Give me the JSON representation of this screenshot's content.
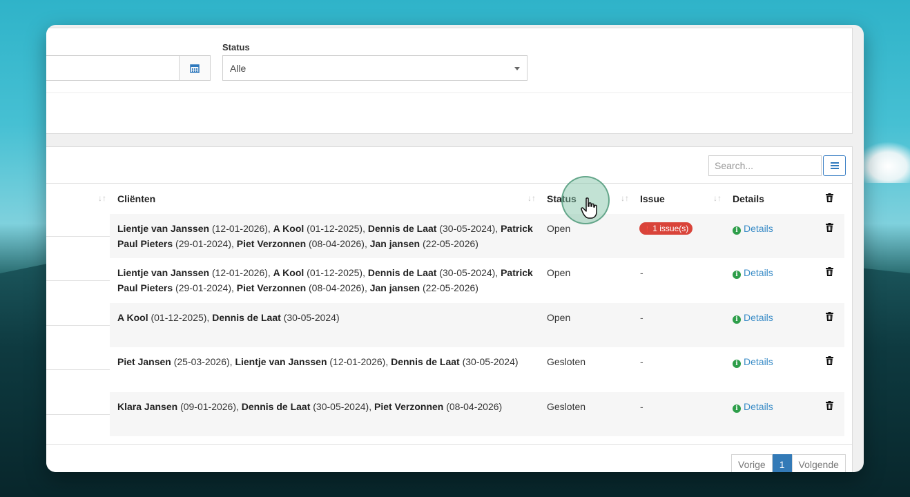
{
  "filters": {
    "status_label": "Status",
    "status_value": "Alle"
  },
  "table": {
    "search_placeholder": "Search...",
    "headers": {
      "clienten": "Cliënten",
      "status": "Status",
      "issue": "Issue",
      "details": "Details"
    },
    "rows": [
      {
        "clients": [
          {
            "name": "Lientje van Janssen",
            "date": "(12-01-2026)"
          },
          {
            "name": "A Kool",
            "date": "(01-12-2025)"
          },
          {
            "name": "Dennis de Laat",
            "date": "(30-05-2024)"
          },
          {
            "name": "Patrick Paul Pieters",
            "date": "(29-01-2024)"
          },
          {
            "name": "Piet Verzonnen",
            "date": "(08-04-2026)"
          },
          {
            "name": "Jan jansen",
            "date": "(22-05-2026)"
          }
        ],
        "status": "Open",
        "issue": "1 issue(s)",
        "issue_is_badge": true,
        "details": "Details"
      },
      {
        "clients": [
          {
            "name": "Lientje van Janssen",
            "date": "(12-01-2026)"
          },
          {
            "name": "A Kool",
            "date": "(01-12-2025)"
          },
          {
            "name": "Dennis de Laat",
            "date": "(30-05-2024)"
          },
          {
            "name": "Patrick Paul Pieters",
            "date": "(29-01-2024)"
          },
          {
            "name": "Piet Verzonnen",
            "date": "(08-04-2026)"
          },
          {
            "name": "Jan jansen",
            "date": "(22-05-2026)"
          }
        ],
        "status": "Open",
        "issue": "-",
        "issue_is_badge": false,
        "details": "Details"
      },
      {
        "clients": [
          {
            "name": "A Kool",
            "date": "(01-12-2025)"
          },
          {
            "name": "Dennis de Laat",
            "date": "(30-05-2024)"
          }
        ],
        "status": "Open",
        "issue": "-",
        "issue_is_badge": false,
        "details": "Details"
      },
      {
        "clients": [
          {
            "name": "Piet Jansen",
            "date": "(25-03-2026)"
          },
          {
            "name": "Lientje van Janssen",
            "date": "(12-01-2026)"
          },
          {
            "name": "Dennis de Laat",
            "date": "(30-05-2024)"
          }
        ],
        "status": "Gesloten",
        "issue": "-",
        "issue_is_badge": false,
        "details": "Details"
      },
      {
        "clients": [
          {
            "name": "Klara Jansen",
            "date": "(09-01-2026)"
          },
          {
            "name": "Dennis de Laat",
            "date": "(30-05-2024)"
          },
          {
            "name": "Piet Verzonnen",
            "date": "(08-04-2026)"
          }
        ],
        "status": "Gesloten",
        "issue": "-",
        "issue_is_badge": false,
        "details": "Details"
      }
    ]
  },
  "pagination": {
    "prev": "Vorige",
    "current": "1",
    "next": "Volgende"
  },
  "icons": {
    "sort": "sort-arrows-icon",
    "trash": "trash-icon",
    "info": "info-circle-icon",
    "calendar": "calendar-icon",
    "cursor": "hand-pointer-icon"
  },
  "colors": {
    "accent": "#337ab7",
    "issue_badge": "#d9443a",
    "info_icon": "#2e9e4a",
    "link": "#3a8cc7"
  }
}
